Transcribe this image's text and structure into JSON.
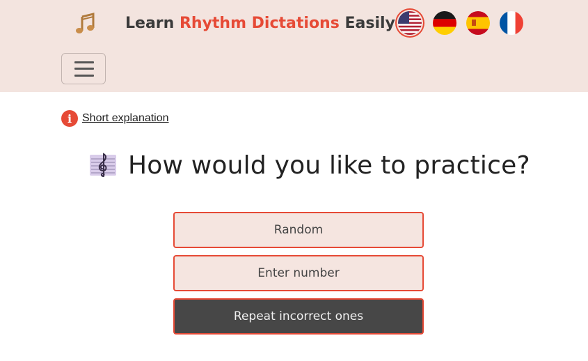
{
  "header": {
    "logo_icon": "music-notes-icon",
    "brand": {
      "part1": "Learn ",
      "accent": "Rhythm Dictations",
      "part2": " Easily"
    },
    "languages": [
      {
        "name": "us-flag-icon",
        "active": true
      },
      {
        "name": "german-flag-icon",
        "active": false
      },
      {
        "name": "spanish-flag-icon",
        "active": false
      },
      {
        "name": "french-flag-icon",
        "active": false
      }
    ],
    "menu_icon": "hamburger-menu-icon"
  },
  "explanation": {
    "icon": "info-icon",
    "icon_text": "i",
    "link": "Short explanation"
  },
  "main": {
    "title_icon": "treble-clef-icon",
    "title": "How would you like to practice?",
    "options": [
      {
        "label": "Random",
        "selected": false
      },
      {
        "label": "Enter number",
        "selected": false
      },
      {
        "label": "Repeat incorrect ones",
        "selected": true
      }
    ]
  },
  "colors": {
    "accent": "#e64a36",
    "header_bg": "#f3e4df",
    "button_bg": "#f5e5e0",
    "button_dark": "#474747"
  }
}
